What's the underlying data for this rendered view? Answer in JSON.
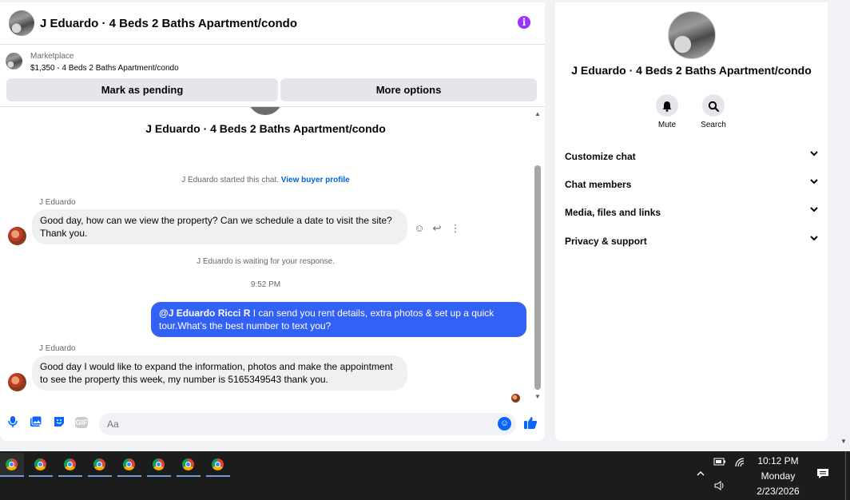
{
  "header": {
    "title": "J Eduardo · 4 Beds 2 Baths Apartment/condo",
    "info_icon": "i"
  },
  "listing": {
    "source": "Marketplace",
    "price_title": "$1,350 - 4 Beds 2 Baths Apartment/condo",
    "mark_pending_label": "Mark as pending",
    "more_options_label": "More options"
  },
  "conversation": {
    "title": "J Eduardo · 4 Beds 2 Baths Apartment/condo",
    "started_note": "J Eduardo started this chat.",
    "view_buyer_profile": "View buyer profile",
    "waiting_note": "J Eduardo is waiting for your response.",
    "timestamp": "9:52 PM",
    "messages": [
      {
        "sender": "J Eduardo",
        "text": "Good day, how can we view the property? Can we schedule a date to visit the site? Thank you."
      },
      {
        "mention": "@J Eduardo Ricci R",
        "text": "  I can send you rent details, extra photos & set up a quick tour.What’s the best number to text you?"
      },
      {
        "sender": "J Eduardo",
        "text": "Good day I would like to expand the information, photos and make the appointment to see the property this week, my number is 5165349543 thank you."
      }
    ]
  },
  "composer": {
    "placeholder": "Aa",
    "gif_label": "GIF",
    "icons": [
      "mic-icon",
      "photo-icon",
      "sticker-icon",
      "gif-icon",
      "emoji-icon",
      "thumbs-up-icon"
    ]
  },
  "info_panel": {
    "title": "J Eduardo · 4 Beds 2 Baths Apartment/condo",
    "mute_label": "Mute",
    "search_label": "Search",
    "rows": [
      {
        "label": "Customize chat"
      },
      {
        "label": "Chat members"
      },
      {
        "label": "Media, files and links"
      },
      {
        "label": "Privacy & support"
      }
    ]
  },
  "taskbar": {
    "apps": [
      "chrome",
      "chrome",
      "chrome",
      "chrome",
      "chrome",
      "chrome",
      "chrome",
      "chrome"
    ],
    "time": "10:12 PM",
    "day": "Monday",
    "date": "2/23/2026"
  },
  "colors": {
    "accent": "#0866ff",
    "outgoing_bubble": "#3360f5",
    "info_icon": "#9b30ff",
    "taskbar": "#1c1c1c"
  }
}
